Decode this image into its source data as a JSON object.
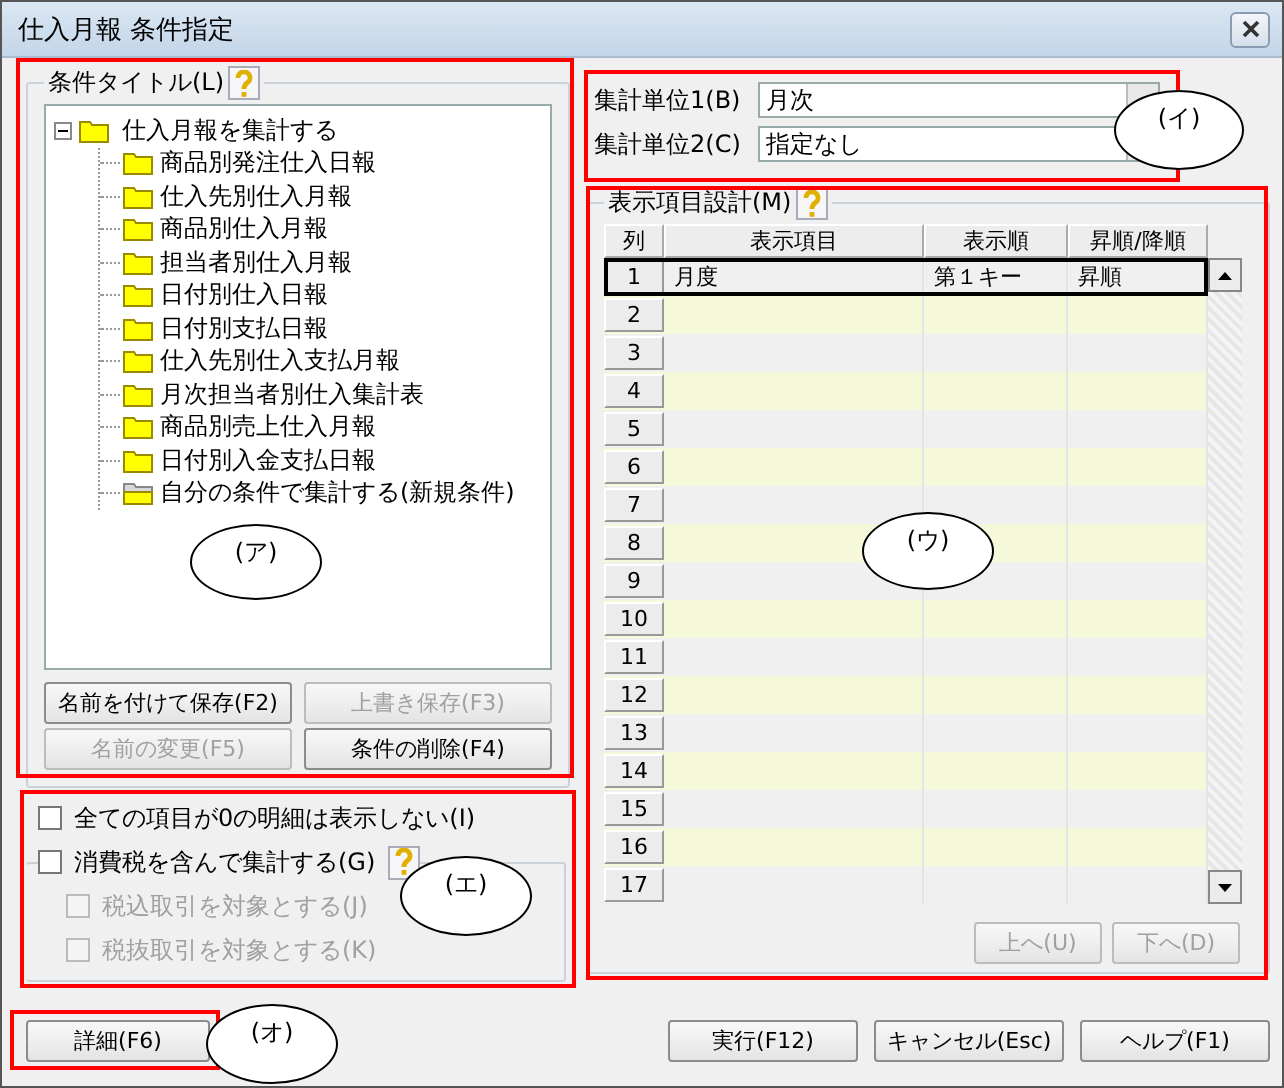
{
  "window": {
    "title": "仕入月報 条件指定"
  },
  "condition_title": {
    "label": "条件タイトル(L)",
    "tree": {
      "label": "仕入月報を集計する",
      "kind": "folder",
      "expanded": true,
      "children": [
        {
          "label": "商品別発注仕入日報",
          "kind": "folder"
        },
        {
          "label": "仕入先別仕入月報",
          "kind": "folder"
        },
        {
          "label": "商品別仕入月報",
          "kind": "folder"
        },
        {
          "label": "担当者別仕入月報",
          "kind": "folder"
        },
        {
          "label": "日付別仕入日報",
          "kind": "folder"
        },
        {
          "label": "日付別支払日報",
          "kind": "folder"
        },
        {
          "label": "仕入先別仕入支払月報",
          "kind": "folder"
        },
        {
          "label": "月次担当者別仕入集計表",
          "kind": "folder"
        },
        {
          "label": "商品別売上仕入月報",
          "kind": "folder"
        },
        {
          "label": "日付別入金支払日報",
          "kind": "folder"
        },
        {
          "label": "自分の条件で集計する(新規条件)",
          "kind": "new"
        }
      ]
    },
    "buttons": [
      {
        "label": "名前を付けて保存(F2)",
        "disabled": false
      },
      {
        "label": "上書き保存(F3)",
        "disabled": true
      },
      {
        "label": "名前の変更(F5)",
        "disabled": true
      },
      {
        "label": "条件の削除(F4)",
        "disabled": false
      }
    ]
  },
  "options": [
    {
      "label": "全ての項目が0の明細は表示しない(I)",
      "checked": false,
      "disabled": false
    },
    {
      "label": "消費税を含んで集計する(G)",
      "checked": false,
      "disabled": false,
      "children": [
        {
          "label": "税込取引を対象とする(J)",
          "checked": false,
          "disabled": true
        },
        {
          "label": "税抜取引を対象とする(K)",
          "checked": false,
          "disabled": true
        }
      ]
    }
  ],
  "aggregation": [
    {
      "label": "集計単位1(B)",
      "value": "月次"
    },
    {
      "label": "集計単位2(C)",
      "value": "指定なし"
    }
  ],
  "display_items": {
    "label": "表示項目設計(M)",
    "columns": [
      "列",
      "表示項目",
      "表示順",
      "昇順/降順"
    ],
    "rows": [
      {
        "number": "1",
        "item": "月度",
        "order": "第１キー",
        "direction": "昇順",
        "selected": true
      },
      {
        "number": "2",
        "selected": false
      },
      {
        "number": "3",
        "selected": false
      },
      {
        "number": "4",
        "selected": false
      },
      {
        "number": "5",
        "selected": false
      },
      {
        "number": "6",
        "selected": false
      },
      {
        "number": "7",
        "selected": false
      },
      {
        "number": "8",
        "selected": false
      },
      {
        "number": "9",
        "selected": false
      },
      {
        "number": "10",
        "selected": false
      },
      {
        "number": "11",
        "selected": false
      },
      {
        "number": "12",
        "selected": false
      },
      {
        "number": "13",
        "selected": false
      },
      {
        "number": "14",
        "selected": false
      },
      {
        "number": "15",
        "selected": false
      },
      {
        "number": "16",
        "selected": false
      },
      {
        "number": "17",
        "selected": false
      }
    ],
    "buttons": [
      {
        "label": "上へ(U)",
        "disabled": true
      },
      {
        "label": "下へ(D)",
        "disabled": true
      }
    ]
  },
  "footer": {
    "detail_button": "詳細(F6)",
    "buttons": [
      "実行(F12)",
      "キャンセル(Esc)",
      "ヘルプ(F1)"
    ]
  },
  "annotations": [
    {
      "label": "(ア)"
    },
    {
      "label": "(イ)"
    },
    {
      "label": "(ウ)"
    },
    {
      "label": "(エ)"
    },
    {
      "label": "(オ)"
    }
  ]
}
